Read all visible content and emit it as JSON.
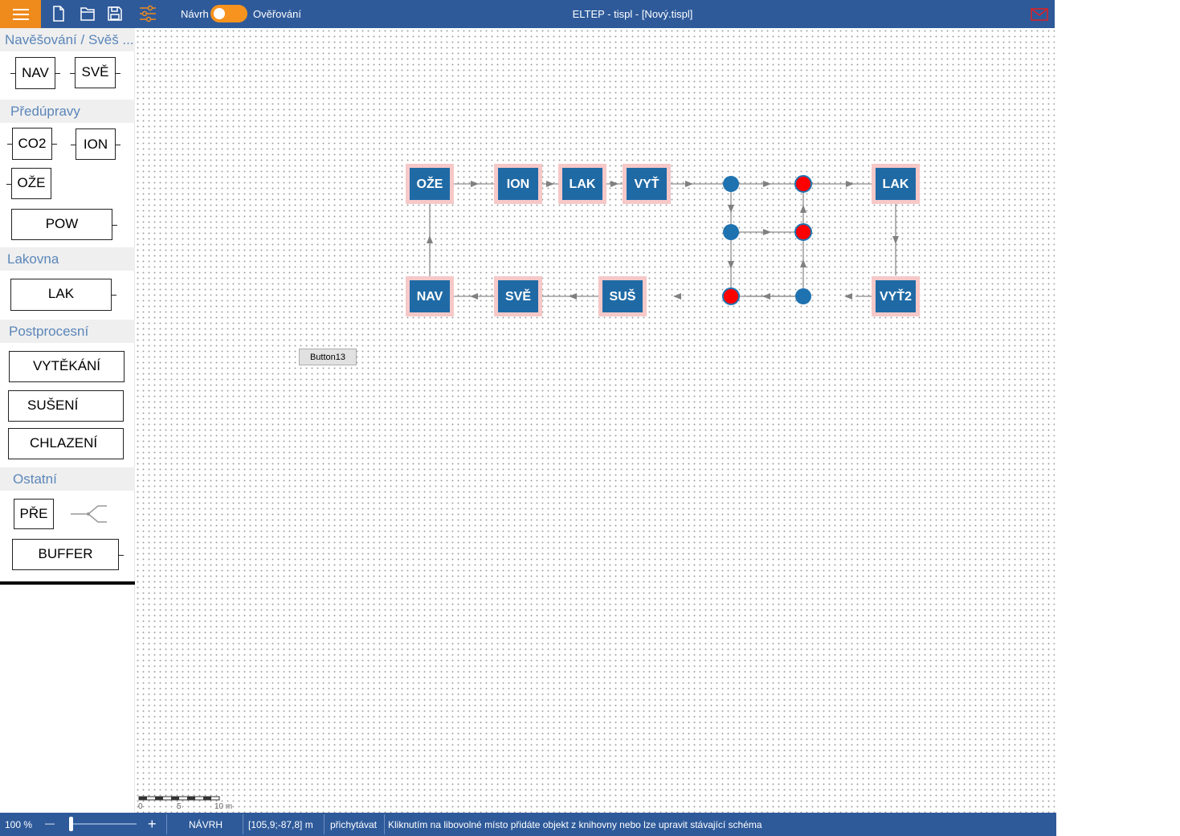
{
  "window": {
    "title": "ELTEP - tispl - [Nový.tispl]"
  },
  "toolbar": {
    "icons": [
      "menu-icon",
      "new-file-icon",
      "open-file-icon",
      "save-icon",
      "settings-sliders-icon"
    ],
    "mode_design_label": "Návrh",
    "mode_verify_label": "Ověřování",
    "mode_toggle_on": true
  },
  "colors": {
    "topbar": "#2e5a9a",
    "accent": "#ef8a1c",
    "block_fill": "#1f6aa5",
    "node_blue": "#1f72b0",
    "node_red": "#ff0000",
    "category_text": "#5b86b9"
  },
  "sidebar": {
    "categories": [
      {
        "title": "Navěšování / Svěš ...",
        "items": [
          "NAV",
          "SVĚ"
        ]
      },
      {
        "title": "Předúpravy",
        "items": [
          "CO2",
          "ION",
          "OŽE",
          "POW"
        ]
      },
      {
        "title": "Lakovna",
        "items": [
          "LAK"
        ]
      },
      {
        "title": "Postprocesní",
        "items": [
          "VYTĚKÁNÍ",
          "SUŠENÍ",
          "CHLAZENÍ"
        ]
      },
      {
        "title": "Ostatní",
        "items": [
          "PŘE",
          "BUFFER"
        ]
      }
    ],
    "extra_icons": [
      "junction-icon"
    ]
  },
  "canvas": {
    "button13_label": "Button13",
    "blocks": [
      "OŽE",
      "ION",
      "LAK",
      "VYŤ",
      "LAK",
      "NAV",
      "SVĚ",
      "SUŠ",
      "VYŤ2"
    ],
    "scale_labels": [
      "0",
      "5",
      "10 m"
    ]
  },
  "statusbar": {
    "zoom": "100 %",
    "zoom_minus": "—",
    "zoom_plus": "+",
    "mode": "NÁVRH",
    "coords": "[105,9;-87,8] m",
    "snap": "přichytávat",
    "hint": "Kliknutím na libovolné místo přidáte objekt z knihovny nebo lze upravit stávající schéma"
  }
}
